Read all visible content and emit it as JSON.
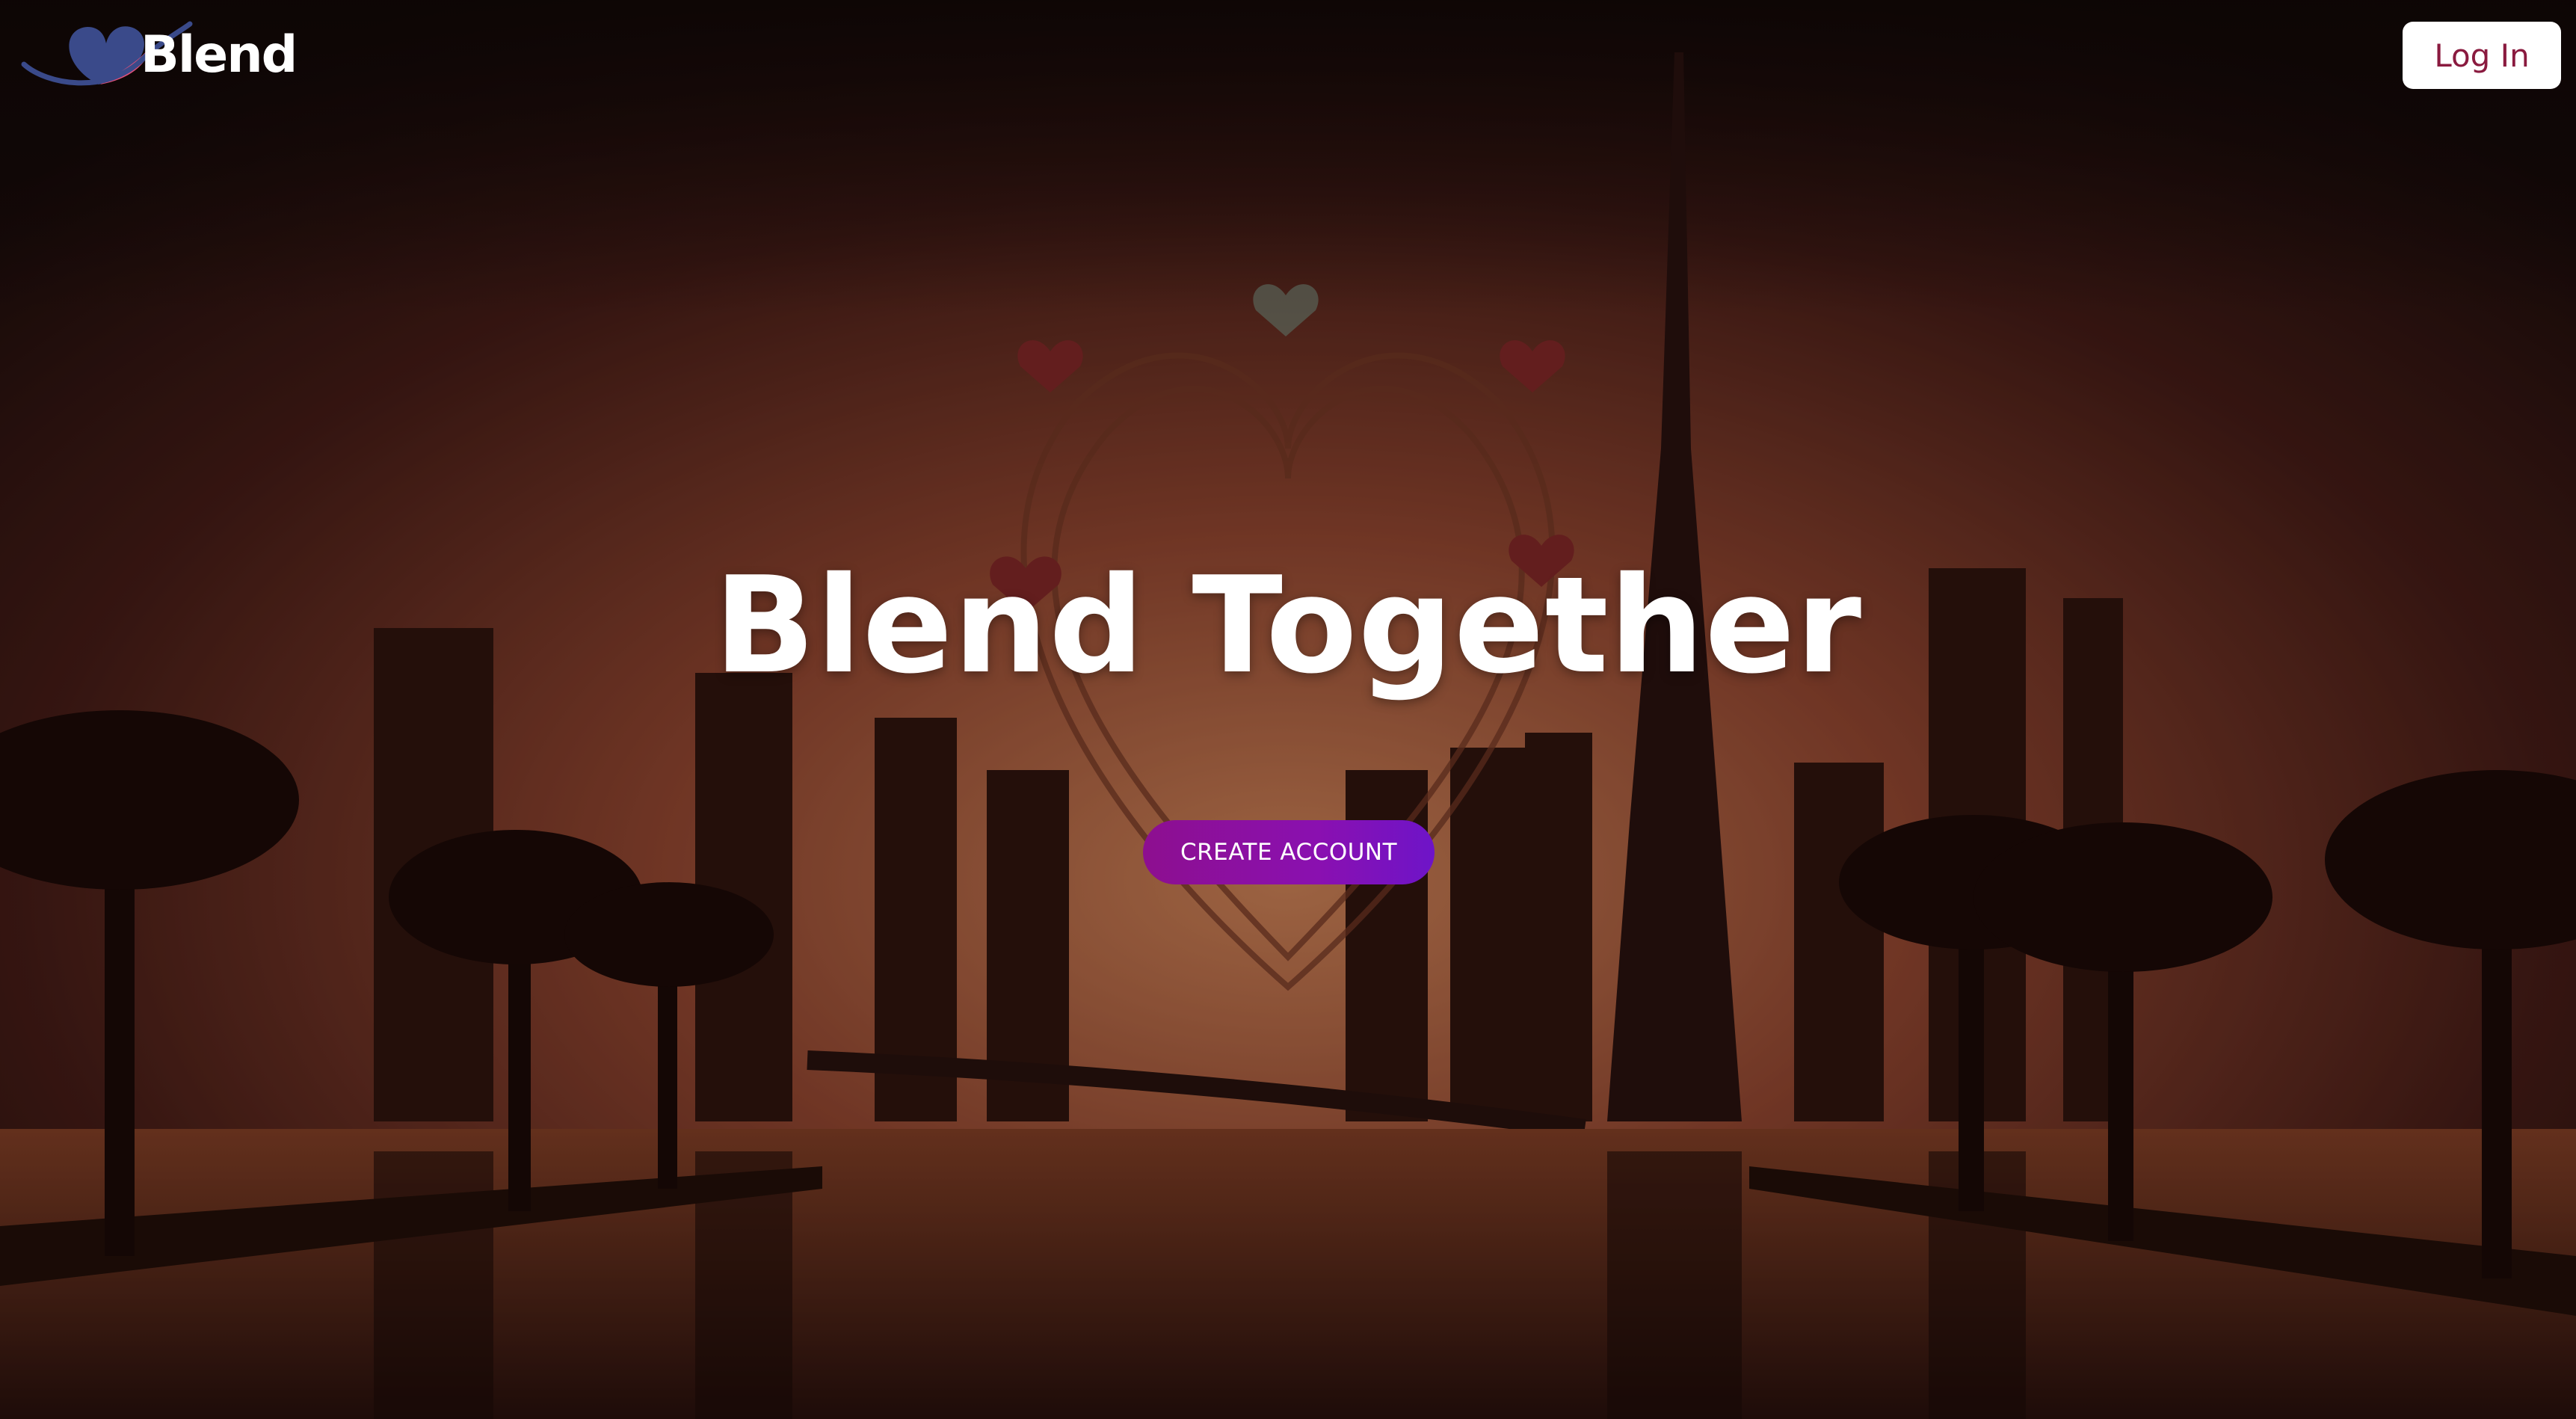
{
  "header": {
    "brand_name": "Blend",
    "login_label": "Log In"
  },
  "hero": {
    "title": "Blend Together",
    "cta_label": "CREATE ACCOUNT",
    "background_scene": "dubai-skyline-heart-hands"
  },
  "colors": {
    "login_text": "#8a1a3f",
    "cta_gradient_start": "#8d0f8f",
    "cta_gradient_end": "#6e14c8",
    "logo_heart_blue": "#3a4a8a",
    "logo_heart_pink": "#e0507a"
  }
}
